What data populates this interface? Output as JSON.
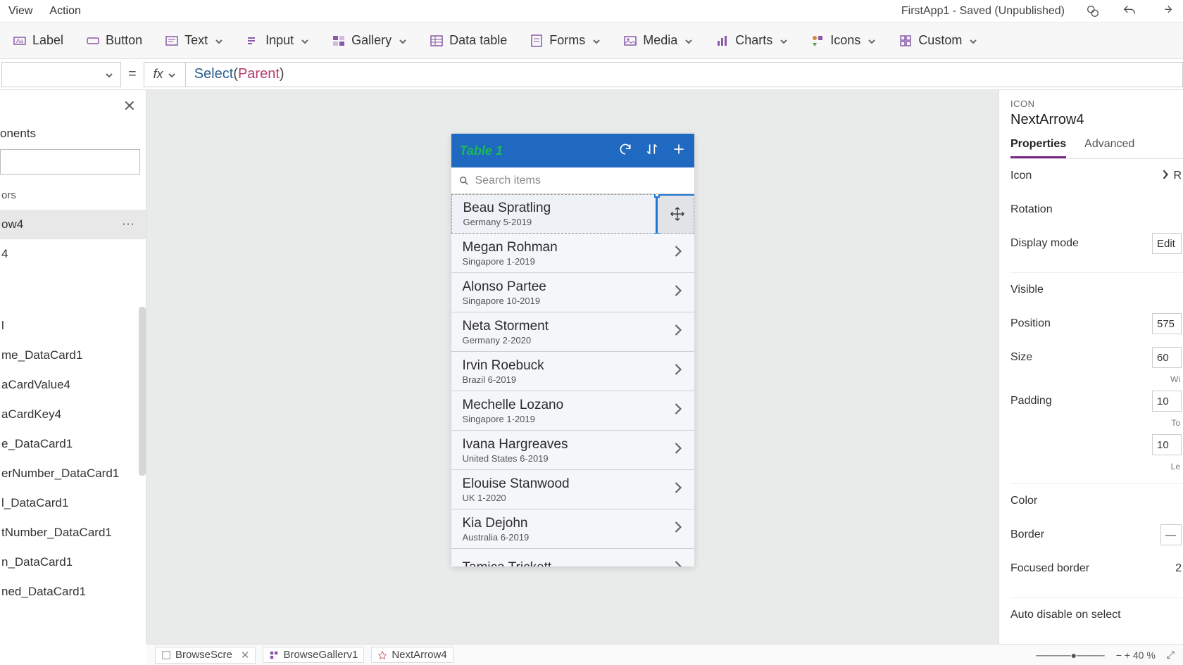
{
  "menu": {
    "view": "View",
    "action": "Action"
  },
  "app": {
    "title": "FirstApp1 - Saved (Unpublished)"
  },
  "ribbon": {
    "label": "Label",
    "button": "Button",
    "text": "Text",
    "input": "Input",
    "gallery": "Gallery",
    "data_table": "Data table",
    "forms": "Forms",
    "media": "Media",
    "charts": "Charts",
    "icons": "Icons",
    "custom": "Custom"
  },
  "formula": {
    "eq": "=",
    "fx": "fx",
    "fn": "Select",
    "arg": "Parent"
  },
  "tree": {
    "tab": "onents",
    "top_item": "ors",
    "selected": "ow4",
    "item2": "4",
    "items": [
      "l",
      "me_DataCard1",
      "aCardValue4",
      "aCardKey4",
      "e_DataCard1",
      "erNumber_DataCard1",
      "l_DataCard1",
      "tNumber_DataCard1",
      "n_DataCard1",
      "ned_DataCard1"
    ]
  },
  "phone": {
    "title": "Table 1",
    "search_placeholder": "Search items",
    "rows": [
      {
        "name": "Beau Spratling",
        "sub": "Germany 5-2019"
      },
      {
        "name": "Megan Rohman",
        "sub": "Singapore 1-2019"
      },
      {
        "name": "Alonso Partee",
        "sub": "Singapore 10-2019"
      },
      {
        "name": "Neta Storment",
        "sub": "Germany 2-2020"
      },
      {
        "name": "Irvin Roebuck",
        "sub": "Brazil 6-2019"
      },
      {
        "name": "Mechelle Lozano",
        "sub": "Singapore 1-2019"
      },
      {
        "name": "Ivana Hargreaves",
        "sub": "United States 6-2019"
      },
      {
        "name": "Elouise Stanwood",
        "sub": "UK 1-2020"
      },
      {
        "name": "Kia Dejohn",
        "sub": "Australia 6-2019"
      },
      {
        "name": "Tamica Trickett",
        "sub": ""
      }
    ]
  },
  "props": {
    "type": "ICON",
    "name": "NextArrow4",
    "tab_props": "Properties",
    "tab_adv": "Advanced",
    "icon": "Icon",
    "icon_val": "R",
    "rotation": "Rotation",
    "display_mode": "Display mode",
    "display_mode_val": "Edit",
    "visible": "Visible",
    "position": "Position",
    "position_x": "575",
    "size_label": "Size",
    "size_w": "60",
    "padding": "Padding",
    "padding_t": "10",
    "padding_l2": "10",
    "color": "Color",
    "border": "Border",
    "focused_border": "Focused border",
    "focused_border_val": "2",
    "auto_disable": "Auto disable on select",
    "sub_wi": "Wi",
    "sub_to": "To",
    "sub_le": "Le"
  },
  "status": {
    "crumb1": "BrowseScre",
    "crumb2": "BrowseGallerv1",
    "crumb3": "NextArrow4",
    "zoom": "40"
  }
}
